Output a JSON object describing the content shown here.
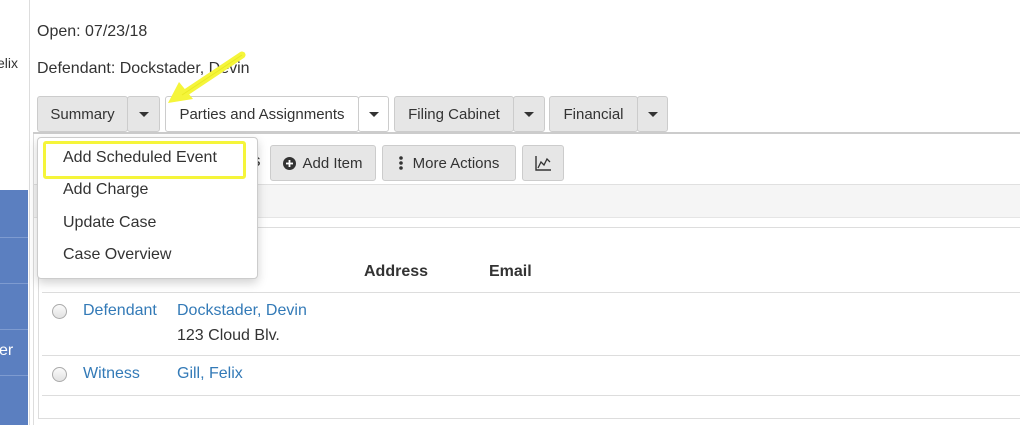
{
  "left_panel": {
    "partial_name": "elix",
    "partial_label": "er"
  },
  "case": {
    "open": "Open: 07/23/18",
    "defendant": "Defendant: Dockstader, Devin"
  },
  "tabs": [
    {
      "label": "Summary"
    },
    {
      "label": "Parties and Assignments"
    },
    {
      "label": "Filing Cabinet"
    },
    {
      "label": "Financial"
    }
  ],
  "actions": {
    "partial_label": "s",
    "add_item": "Add Item",
    "more_actions": "More Actions"
  },
  "dropdown": {
    "items": [
      "Add Scheduled Event",
      "Add Charge",
      "Update Case",
      "Case Overview"
    ],
    "highlight_color": "#f5f53a"
  },
  "table": {
    "headers": {
      "address": "Address",
      "email": "Email"
    },
    "rows": [
      {
        "type": "Defendant",
        "name": "Dockstader, Devin",
        "address": "123 Cloud Blv."
      },
      {
        "type": "Witness",
        "name": "Gill, Felix",
        "address": ""
      }
    ]
  },
  "colors": {
    "link": "#337ab7",
    "arrow": "#f5f53a",
    "sidebar": "#5b7fc0"
  }
}
